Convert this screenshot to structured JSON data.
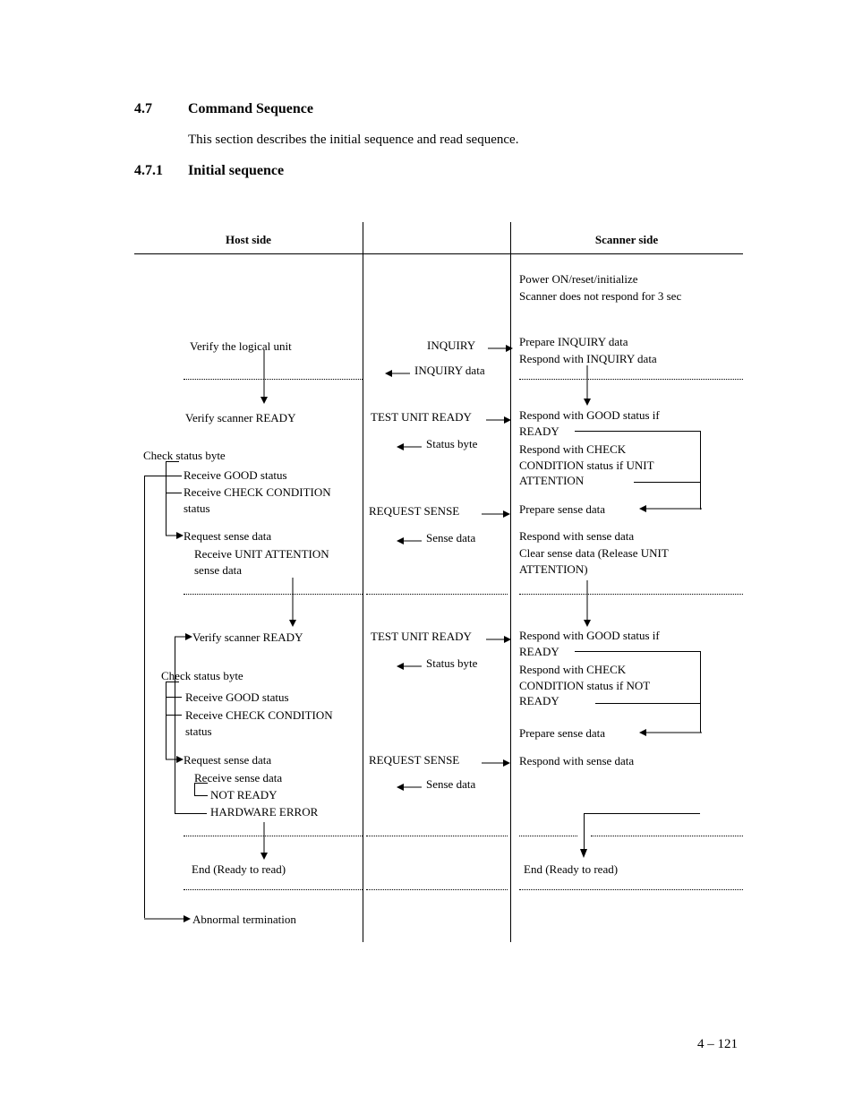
{
  "section": {
    "num1": "4.7",
    "title1": "Command Sequence",
    "intro": "This section describes the initial sequence and read sequence.",
    "num2": "4.7.1",
    "title2": "Initial sequence"
  },
  "headers": {
    "host": "Host side",
    "scanner": "Scanner side"
  },
  "host": {
    "verify_lu": "Verify the logical unit",
    "verify_ready1": "Verify  scanner READY",
    "check_status1": "Check status byte",
    "recv_good1": "Receive GOOD status",
    "recv_check1": "Receive CHECK CONDITION status",
    "req_sense1": "Request sense data",
    "recv_ua": "Receive UNIT ATTENTION sense data",
    "verify_ready2": "Verify scanner READY",
    "check_status2": "Check status byte",
    "recv_good2": "Receive GOOD status",
    "recv_check2": "Receive CHECK CONDITION status",
    "req_sense2": "Request sense data",
    "recv_sense": "Receive sense data",
    "not_ready": "NOT READY",
    "hw_error": "HARDWARE ERROR",
    "end": "End (Ready to read)",
    "abnormal": "Abnormal termination"
  },
  "mid": {
    "inquiry": "INQUIRY",
    "inquiry_data": "INQUIRY data",
    "tur1": "TEST UNIT READY",
    "status1": "Status byte",
    "reqsense1": "REQUEST SENSE",
    "sensedata1": "Sense data",
    "tur2": "TEST UNIT READY",
    "status2": "Status byte",
    "reqsense2": "REQUEST SENSE",
    "sensedata2": "Sense data"
  },
  "scanner": {
    "power": "Power ON/reset/initialize",
    "no_respond": "Scanner does not respond for 3 sec",
    "prep_inq": "Prepare INQUIRY data",
    "resp_inq": "Respond with INQUIRY data",
    "resp_good1": "Respond with GOOD status if READY",
    "resp_check1": "Respond with CHECK CONDITION status if UNIT ATTENTION",
    "prep_sense1": "Prepare sense data",
    "resp_sense1": "Respond with sense data",
    "clear_sense": "Clear sense data (Release UNIT ATTENTION)",
    "resp_good2": "Respond with GOOD status if READY",
    "resp_check2": "Respond with CHECK CONDITION status if NOT READY",
    "prep_sense2": "Prepare sense data",
    "resp_sense2": "Respond with sense data",
    "end": "End (Ready to read)"
  },
  "page_number": "4 – 121"
}
